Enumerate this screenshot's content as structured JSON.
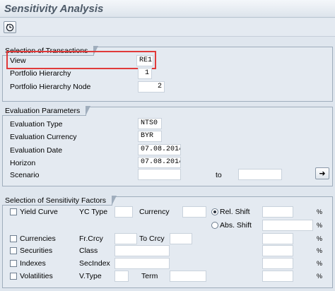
{
  "window": {
    "title": "Sensitivity Analysis"
  },
  "toolbar": {
    "execute_icon": "execute-clock-icon"
  },
  "selection_of_transactions": {
    "header": "Selection of Transactions",
    "view_label": "View",
    "view_value": "RE1",
    "portfolio_hierarchy_label": "Portfolio Hierarchy",
    "portfolio_hierarchy_value": "1",
    "portfolio_hierarchy_node_label": "Portfolio Hierarchy Node",
    "portfolio_hierarchy_node_value": "2"
  },
  "evaluation_parameters": {
    "header": "Evaluation Parameters",
    "evaluation_type_label": "Evaluation Type",
    "evaluation_type_value": "NTS0",
    "evaluation_currency_label": "Evaluation Currency",
    "evaluation_currency_value": "BYR",
    "evaluation_date_label": "Evaluation Date",
    "evaluation_date_value": "07.08.2014",
    "horizon_label": "Horizon",
    "horizon_value": "07.08.2014",
    "scenario_label": "Scenario",
    "scenario_from_value": "",
    "scenario_to_label": "to",
    "scenario_to_value": "",
    "multiple_selection_icon": "arrow-right-icon"
  },
  "sensitivity_factors": {
    "header": "Selection of Sensitivity Factors",
    "yield_curve_label": "Yield Curve",
    "yc_type_label": "YC Type",
    "currency_label": "Currency",
    "rel_shift_label": "Rel. Shift",
    "abs_shift_label": "Abs. Shift",
    "currencies_label": "Currencies",
    "fr_crcy_label": "Fr.Crcy",
    "to_crcy_label": "To Crcy",
    "securities_label": "Securities",
    "class_label": "Class",
    "indexes_label": "Indexes",
    "secindex_label": "SecIndex",
    "volatilities_label": "Volatilities",
    "v_type_label": "V.Type",
    "term_label": "Term",
    "percent_sign": "%",
    "selected_shift": "Rel. Shift"
  },
  "colors": {
    "background": "#dfe6ee",
    "group_border": "#9fadbc",
    "highlight": "#e03a3a",
    "title": "#4d5a68"
  }
}
